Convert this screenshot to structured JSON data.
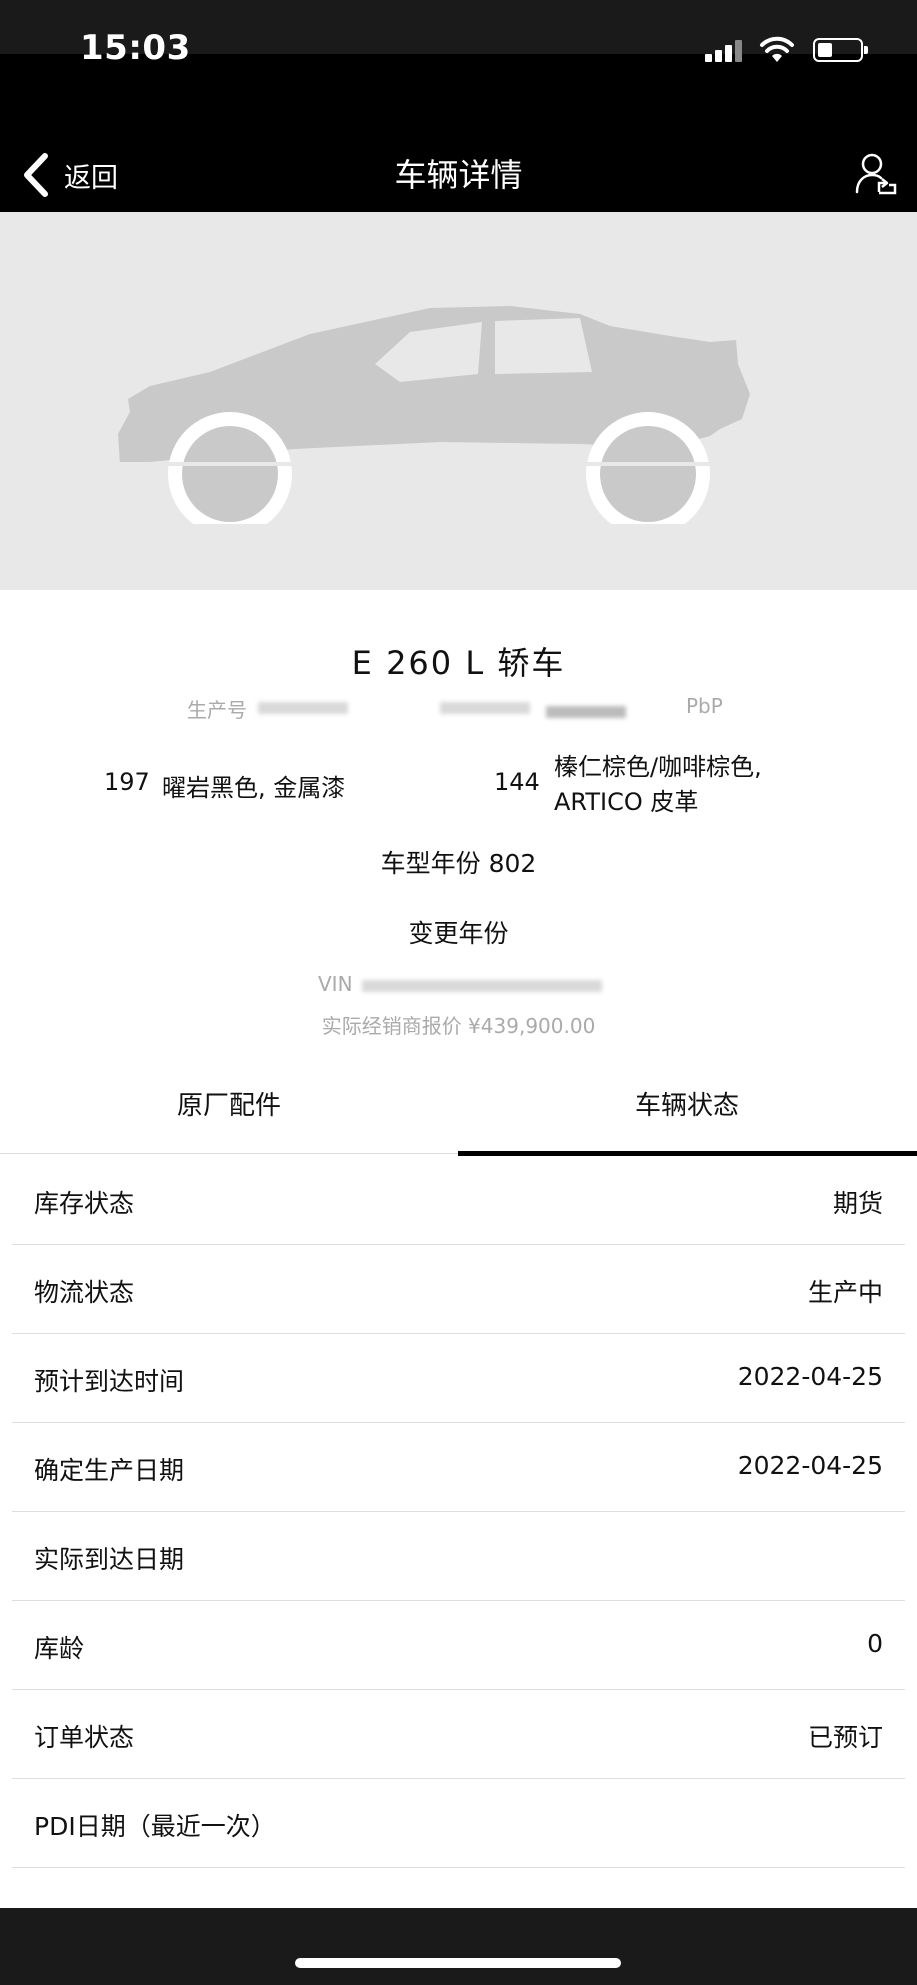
{
  "status_bar": {
    "time": "15:03"
  },
  "nav": {
    "back_label": "返回",
    "title": "车辆详情"
  },
  "vehicle": {
    "model": "E 260 L 轿车",
    "production_label": "生产号",
    "production_suffix": "PbP",
    "paint_code": "197",
    "paint_name": "曜岩黑色, 金属漆",
    "trim_code": "144",
    "trim_name": "榛仁棕色/咖啡棕色, ARTICO 皮革",
    "model_year": "车型年份 802",
    "change_year": "变更年份",
    "vin_label": "VIN",
    "price": "实际经销商报价 ¥439,900.00"
  },
  "tabs": [
    {
      "label": "原厂配件",
      "active": false
    },
    {
      "label": "车辆状态",
      "active": true
    }
  ],
  "status_rows": [
    {
      "key": "库存状态",
      "value": "期货"
    },
    {
      "key": "物流状态",
      "value": "生产中"
    },
    {
      "key": "预计到达时间",
      "value": "2022-04-25"
    },
    {
      "key": "确定生产日期",
      "value": "2022-04-25"
    },
    {
      "key": "实际到达日期",
      "value": ""
    },
    {
      "key": "库龄",
      "value": "0"
    },
    {
      "key": "订单状态",
      "value": "已预订"
    },
    {
      "key": "PDI日期（最近一次）",
      "value": ""
    }
  ],
  "icons": {
    "back": "chevron-left-icon",
    "user": "user-share-icon",
    "car": "car-silhouette-icon",
    "signal": "cellular-signal-icon",
    "wifi": "wifi-icon",
    "battery": "battery-icon"
  }
}
